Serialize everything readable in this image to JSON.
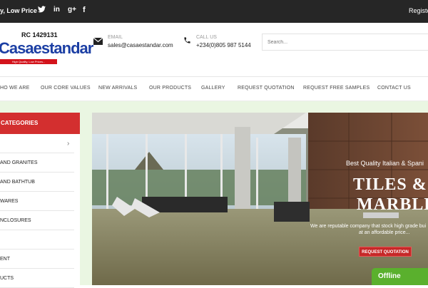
{
  "topbar": {
    "tagline": "y, Low Price",
    "social": [
      {
        "name": "twitter-icon",
        "glyph": "🐦"
      },
      {
        "name": "linkedin-icon",
        "glyph": "in"
      },
      {
        "name": "googleplus-icon",
        "glyph": "g+"
      },
      {
        "name": "facebook-icon",
        "glyph": "f"
      }
    ],
    "register_label": "Register"
  },
  "header": {
    "rc_number": "RC 1429131",
    "logo_text": "Casaestandar",
    "logo_tagline": "High Quality, Low Prices...",
    "email_label": "EMAIL",
    "email_value": "sales@casaestandar.com",
    "phone_label": "CALL US",
    "phone_value": "+234(0)805 987 5144",
    "search_placeholder": "Search..."
  },
  "nav": {
    "items": [
      "HO WE ARE",
      "OUR CORE VALUES",
      "NEW ARRIVALS",
      "OUR PRODUCTS",
      "GALLERY",
      "REQUEST QUOTATION",
      "REQUEST FREE SAMPLES",
      "CONTACT US"
    ]
  },
  "sidebar": {
    "header": "CATEGORIES",
    "items": [
      "",
      "AND GRANITES",
      "AND BATHTUB",
      "WARES",
      "NCLOSURES",
      "",
      "ENT",
      "UCTS"
    ]
  },
  "banner": {
    "subtitle": "Best Quality Italian & Spani",
    "headline_1": "TILES &",
    "headline_2": "MARBLES",
    "description_1": "We are reputable company that stock high grade bui",
    "description_2": "at an affordable price...",
    "button_label": "REQUEST QUOTATION"
  },
  "chat": {
    "status_label": "Offline"
  },
  "colors": {
    "topbar": "#262626",
    "accent_red": "#d32f2f",
    "logo_blue": "#1c3fa4",
    "offline_green": "#5ab02d",
    "band_green": "#eaf6e2"
  }
}
